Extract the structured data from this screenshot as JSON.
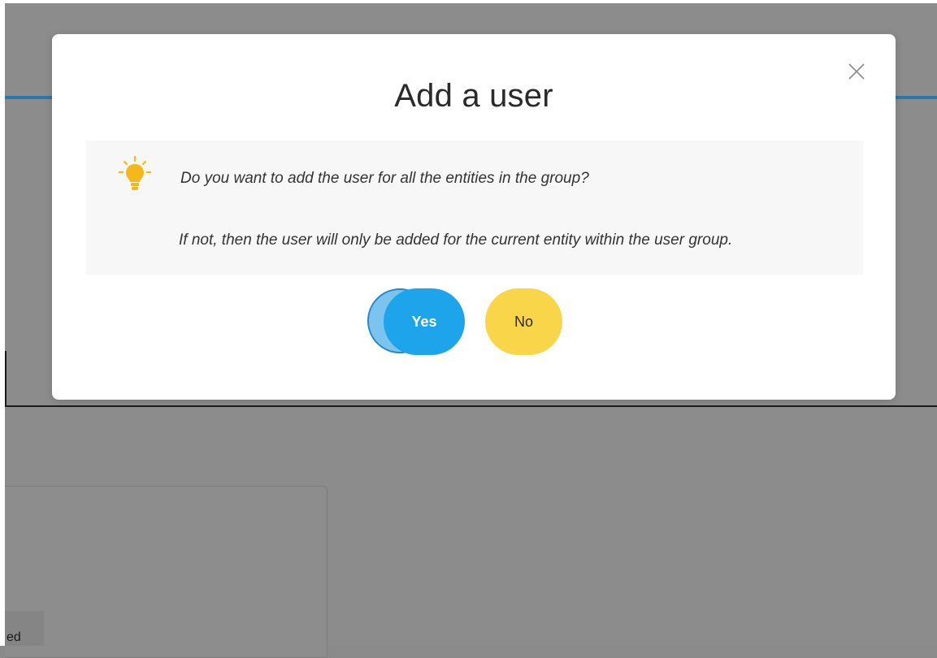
{
  "background": {
    "partial_label": "ed"
  },
  "modal": {
    "title": "Add a user",
    "close_icon": "close-icon",
    "info": {
      "icon": "lightbulb-icon",
      "question": "Do you want to add the user for all the entities in the group?",
      "note": "If not, then the user will only be added for the current entity within the user group."
    },
    "buttons": {
      "yes_label": "Yes",
      "no_label": "No"
    }
  },
  "colors": {
    "accent_blue": "#1ea4ea",
    "accent_yellow": "#f9d54a",
    "bulb_yellow": "#f5b81b",
    "overlay_gray": "#8c8c8c"
  }
}
